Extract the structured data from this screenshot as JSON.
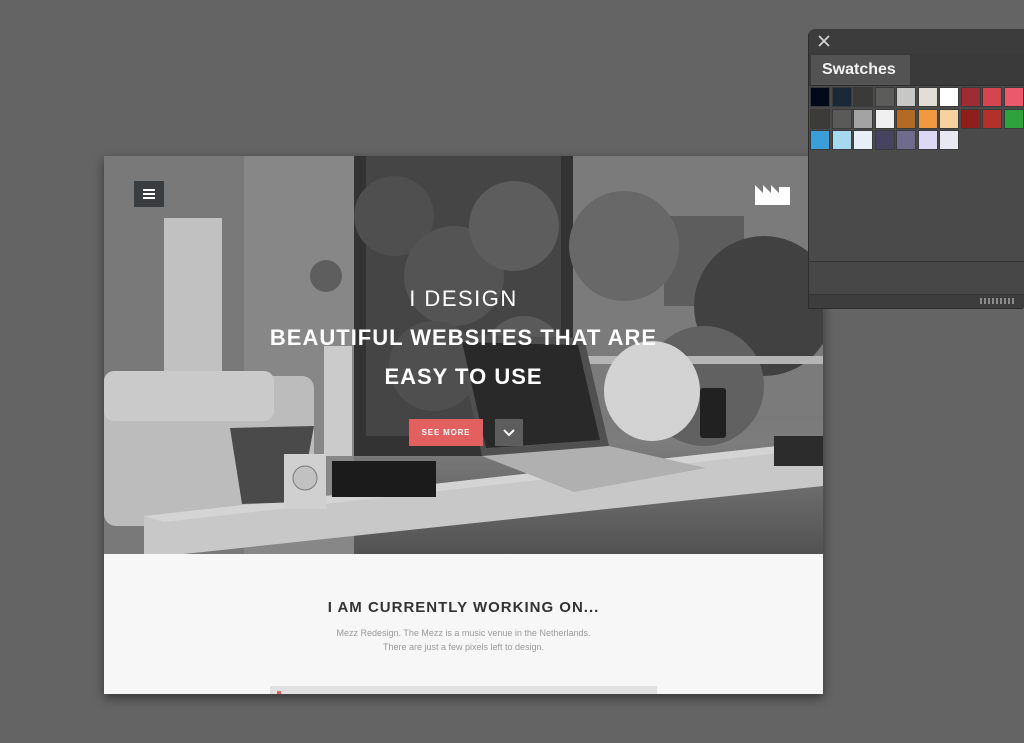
{
  "hero": {
    "line1": "I DESIGN",
    "line2": "BEAUTIFUL WEBSITES THAT ARE",
    "line3": "EASY TO USE",
    "see_more_label": "SEE MORE",
    "menu_icon": "hamburger-icon",
    "logo_icon": "factory-logo",
    "scroll_icon": "chevron-down-icon"
  },
  "working": {
    "title": "I AM CURRENTLY WORKING ON...",
    "description": "Mezz Redesign. The Mezz is a music venue in the Netherlands. There are just a few pixels left to design."
  },
  "colors": {
    "accent": "#e2605f",
    "canvas": "#646464",
    "content_bg": "#f7f7f7"
  },
  "swatches_panel": {
    "tab_label": "Swatches",
    "close_icon": "close-icon",
    "rows": [
      [
        "#020a1a",
        "#1b2838",
        "#3a3a38",
        "#5c5c5a",
        "#c7c7c5",
        "#e2ddd6",
        "#ffffff",
        "#9e2c34",
        "#d44550",
        "#ea5a6c"
      ],
      [
        "#3d3b38",
        "#5a5a58",
        "#a3a3a3",
        "#f0f0f0",
        "#b36a24",
        "#ef9a40",
        "#f8d1a0",
        "#8e1f1a",
        "#b4302a",
        "#2fa23e"
      ],
      [
        "#3a9fd8",
        "#a6d8f0",
        "#e7eef5",
        "#45435e",
        "#6f6b8c",
        "#dcd8f6",
        "#e8e8f2"
      ]
    ]
  }
}
